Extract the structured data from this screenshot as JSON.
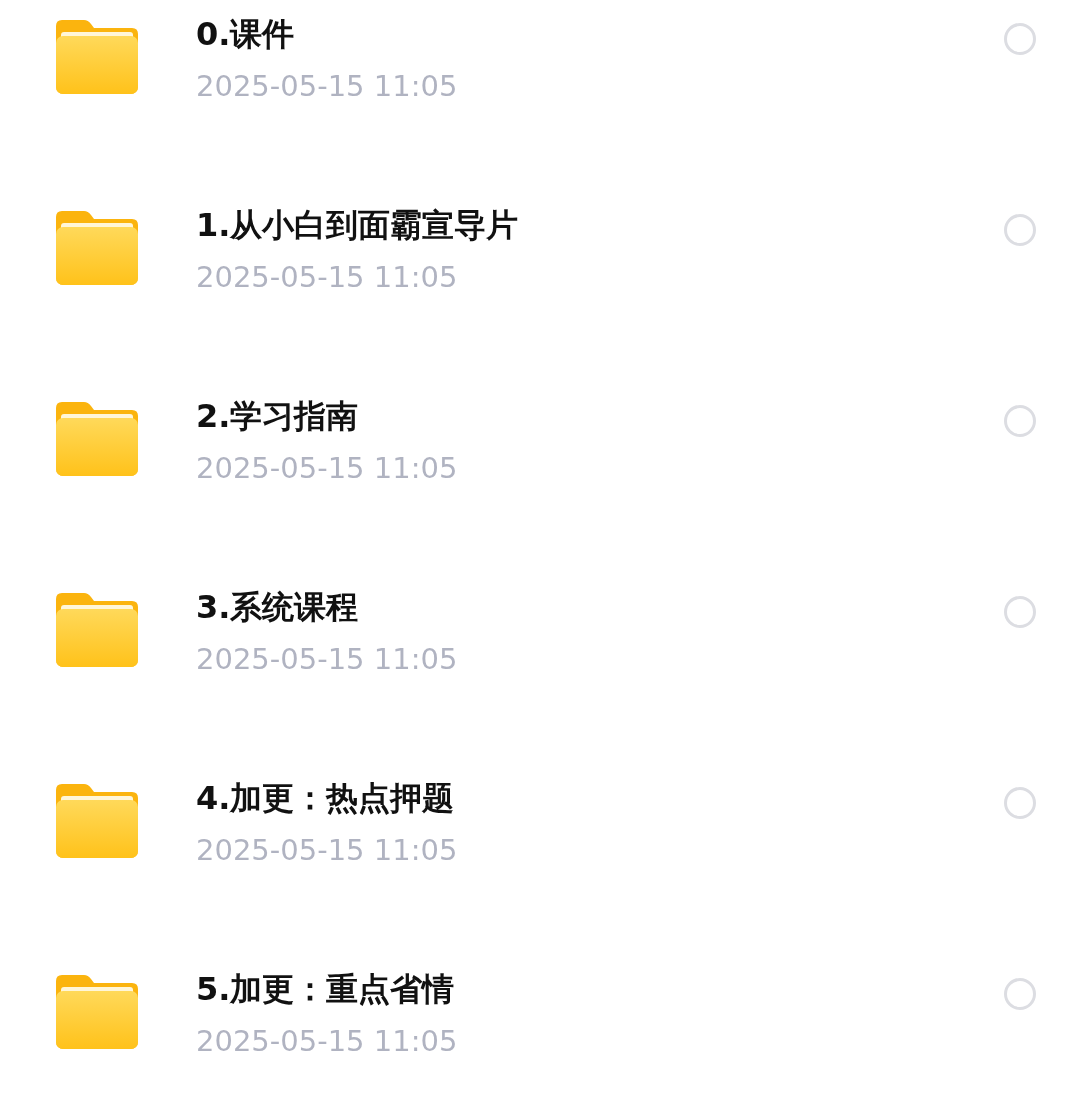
{
  "files": [
    {
      "name": "0.课件",
      "date": "2025-05-15 11:05",
      "selected": false
    },
    {
      "name": "1.从小白到面霸宣导片",
      "date": "2025-05-15 11:05",
      "selected": false
    },
    {
      "name": "2.学习指南",
      "date": "2025-05-15 11:05",
      "selected": false
    },
    {
      "name": "3.系统课程",
      "date": "2025-05-15 11:05",
      "selected": false
    },
    {
      "name": "4.加更：热点押题",
      "date": "2025-05-15 11:05",
      "selected": false
    },
    {
      "name": "5.加更：重点省情",
      "date": "2025-05-15 11:05",
      "selected": false
    }
  ]
}
